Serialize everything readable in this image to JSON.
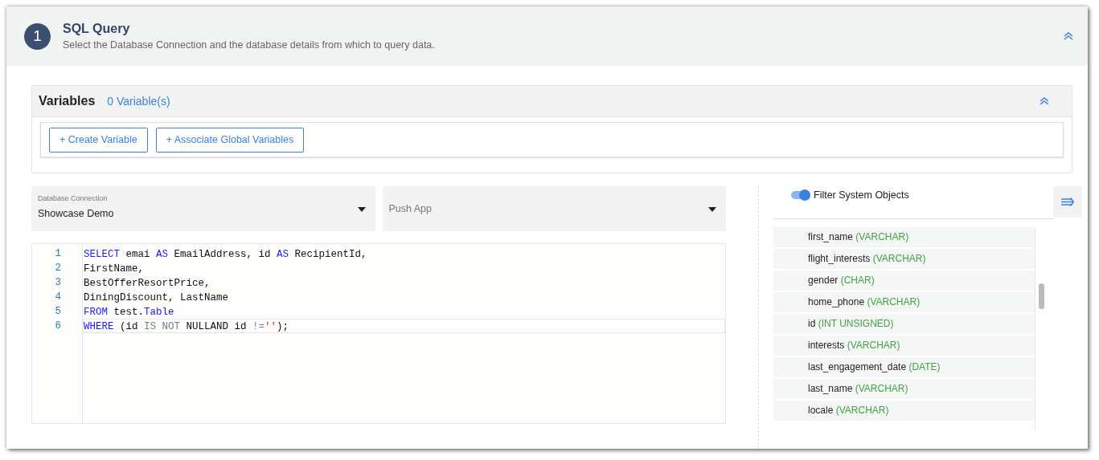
{
  "step": {
    "number": "1",
    "title": "SQL Query",
    "description": "Select the Database Connection and the database details from which to query data.",
    "expanded": true
  },
  "variables": {
    "title": "Variables",
    "count": "0 Variable(s)",
    "expanded": true,
    "buttons": [
      "+ Create Variable",
      "+ Associate Global Variables"
    ]
  },
  "database_connection": {
    "label": "Database Connection",
    "value": "Showcase Demo"
  },
  "push_app": {
    "placeholder": "Push App"
  },
  "editor": {
    "lines": [
      {
        "number": "1",
        "active": false,
        "tokens": [
          {
            "kind": "keyword",
            "text": "SELECT"
          },
          {
            "kind": "plain",
            "text": " emai "
          },
          {
            "kind": "keyword",
            "text": "AS"
          },
          {
            "kind": "plain",
            "text": " EmailAddress, id "
          },
          {
            "kind": "keyword",
            "text": "AS"
          },
          {
            "kind": "plain",
            "text": " RecipientId,"
          }
        ]
      },
      {
        "number": "2",
        "active": false,
        "tokens": [
          {
            "kind": "plain",
            "text": "FirstName,"
          }
        ]
      },
      {
        "number": "3",
        "active": false,
        "tokens": [
          {
            "kind": "plain",
            "text": "BestOfferResortPrice,"
          }
        ]
      },
      {
        "number": "4",
        "active": false,
        "tokens": [
          {
            "kind": "plain",
            "text": "DiningDiscount, LastName"
          }
        ]
      },
      {
        "number": "5",
        "active": false,
        "tokens": [
          {
            "kind": "keyword",
            "text": "FROM"
          },
          {
            "kind": "plain",
            "text": " test."
          },
          {
            "kind": "keyword",
            "text": "Table"
          }
        ]
      },
      {
        "number": "6",
        "active": true,
        "tokens": [
          {
            "kind": "keyword",
            "text": "WHERE"
          },
          {
            "kind": "plain",
            "text": " (id "
          },
          {
            "kind": "operator",
            "text": "IS NOT"
          },
          {
            "kind": "plain",
            "text": " NULLAND id "
          },
          {
            "kind": "operator",
            "text": "!="
          },
          {
            "kind": "string",
            "text": "''"
          },
          {
            "kind": "plain",
            "text": ");"
          }
        ]
      }
    ]
  },
  "filter_system_objects": {
    "label": "Filter System Objects",
    "on": true
  },
  "columns": [
    {
      "name": "first_name",
      "type": "(VARCHAR)"
    },
    {
      "name": "flight_interests",
      "type": "(VARCHAR)"
    },
    {
      "name": "gender",
      "type": "(CHAR)"
    },
    {
      "name": "home_phone",
      "type": "(VARCHAR)"
    },
    {
      "name": "id",
      "type": "(INT UNSIGNED)"
    },
    {
      "name": "interests",
      "type": "(VARCHAR)"
    },
    {
      "name": "last_engagement_date",
      "type": "(DATE)"
    },
    {
      "name": "last_name",
      "type": "(VARCHAR)"
    },
    {
      "name": "locale",
      "type": "(VARCHAR)"
    }
  ]
}
